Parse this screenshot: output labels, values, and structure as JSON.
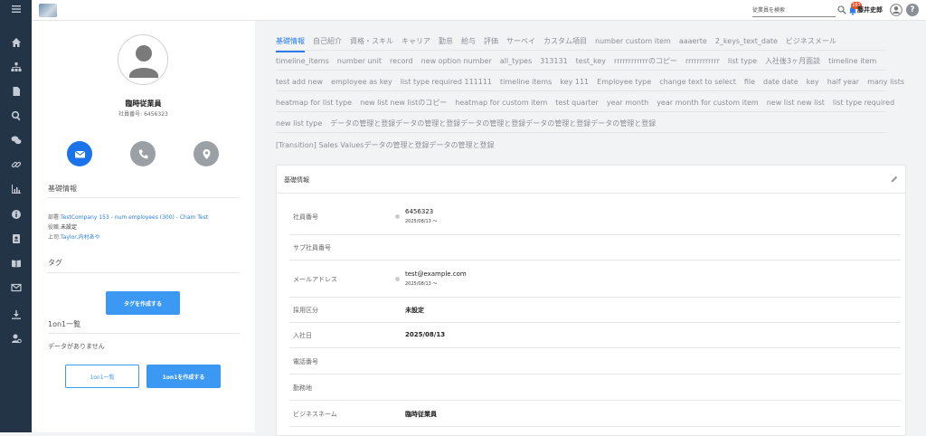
{
  "topbar": {
    "search_placeholder": "従業員を検索",
    "notification_count": "187",
    "user_name": "藤井史郎",
    "help": "?"
  },
  "sidebar_icons": [
    "menu-icon",
    "home-icon",
    "org-chart-icon",
    "document-icon",
    "search-icon",
    "chat-icon",
    "link-icon",
    "chart-icon",
    "info-icon",
    "id-card-icon",
    "book-icon",
    "mail-icon",
    "download-icon",
    "user-settings-icon"
  ],
  "profile": {
    "name": "臨時従業員",
    "employee_number": "社員番号: 6456323"
  },
  "contact_colors": {
    "mail": "#1a73e8",
    "phone": "#9aa0a6",
    "location": "#9aa0a6"
  },
  "basic_info": {
    "title": "基礎情報",
    "dept_label": "部署:",
    "dept_value": "TestCompany 153 - num employees (300) - Cham Test",
    "role_label": "役職:",
    "role_value": "未設定",
    "boss_label": "上司:",
    "boss_value": "Taylor,内村あや"
  },
  "tags": {
    "title": "タグ",
    "create_button": "タグを作成する"
  },
  "one_on_one": {
    "title": "1on1一覧",
    "empty": "データがありません",
    "list_button": "1on1一覧",
    "create_button": "1on1を作成する"
  },
  "tabs": {
    "row1": [
      "基礎情報",
      "自己紹介",
      "資格・スキル",
      "キャリア",
      "勤怠",
      "給与",
      "評価",
      "サーベイ",
      "カスタム項目",
      "number custom item",
      "aaaerte",
      "2_keys_text_date",
      "ビジネスメール"
    ],
    "row2": [
      "timeline_items",
      "number unit",
      "record",
      "new option number",
      "all_types",
      "313131",
      "test_key",
      "rrrrrrrrrrrrのコピー",
      "rrrrrrrrrrrr",
      "list type",
      "入社後3ヶ月面談",
      "timeline item"
    ],
    "row3": [
      "test add new",
      "employee as key",
      "list type required 111111",
      "timeline items",
      "key 111",
      "Employee type",
      "change text to select",
      "file",
      "date date",
      "key",
      "half year",
      "many lists"
    ],
    "row4": [
      "heatmap for list type",
      "new list new listのコピー",
      "heatmap for custom item",
      "test quarter",
      "year month",
      "year month for custom item",
      "new list new list",
      "list type required"
    ],
    "row5": [
      "new list type",
      "データの管理と登録データの管理と登録データの管理と登録データの管理と登録データの管理と登録"
    ],
    "row6": [
      "[Transition] Sales Valuesデータの管理と登録データの管理と登録"
    ]
  },
  "card": {
    "title": "基礎情報",
    "fields": [
      {
        "label": "社員番号",
        "value": "6456323",
        "sub": "2025/08/13 ～"
      },
      {
        "label": "サブ社員番号",
        "value": "",
        "sub": ""
      },
      {
        "label": "メールアドレス",
        "value": "test@example.com",
        "sub": "2025/08/13 ～"
      },
      {
        "label": "採用区分",
        "value": "未設定",
        "sub": ""
      },
      {
        "label": "入社日",
        "value": "2025/08/13",
        "sub": ""
      },
      {
        "label": "電話番号",
        "value": "",
        "sub": ""
      },
      {
        "label": "勤務地",
        "value": "",
        "sub": ""
      },
      {
        "label": "ビジネスネーム",
        "value": "臨時従業員",
        "sub": ""
      }
    ]
  }
}
